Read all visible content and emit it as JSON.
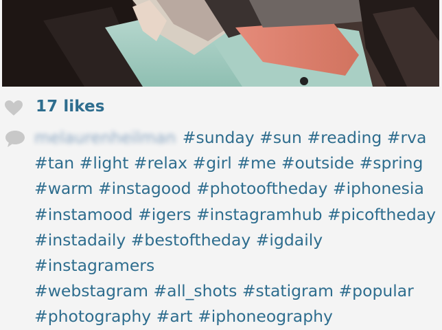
{
  "post": {
    "username": "melaurenheilman",
    "likes_text": "17 likes",
    "caption_lines": [
      "#sunday #sun #reading #rva",
      "#tan #light #relax #girl #me #outside #spring",
      "#warm #instagood #photooftheday #iphonesia",
      "#instamood #igers #instagramhub #picoftheday",
      "#instadaily #bestoftheday #igdaily #instagramers",
      "#webstagram #all_shots #statigram #popular",
      "#photography #art #iphoneography"
    ]
  },
  "colors": {
    "link": "#2e6d8e",
    "icon": "#c8c8c8",
    "background": "#f4f4f4"
  },
  "icons": {
    "like": "heart-icon",
    "comment": "speech-bubble-icon"
  }
}
